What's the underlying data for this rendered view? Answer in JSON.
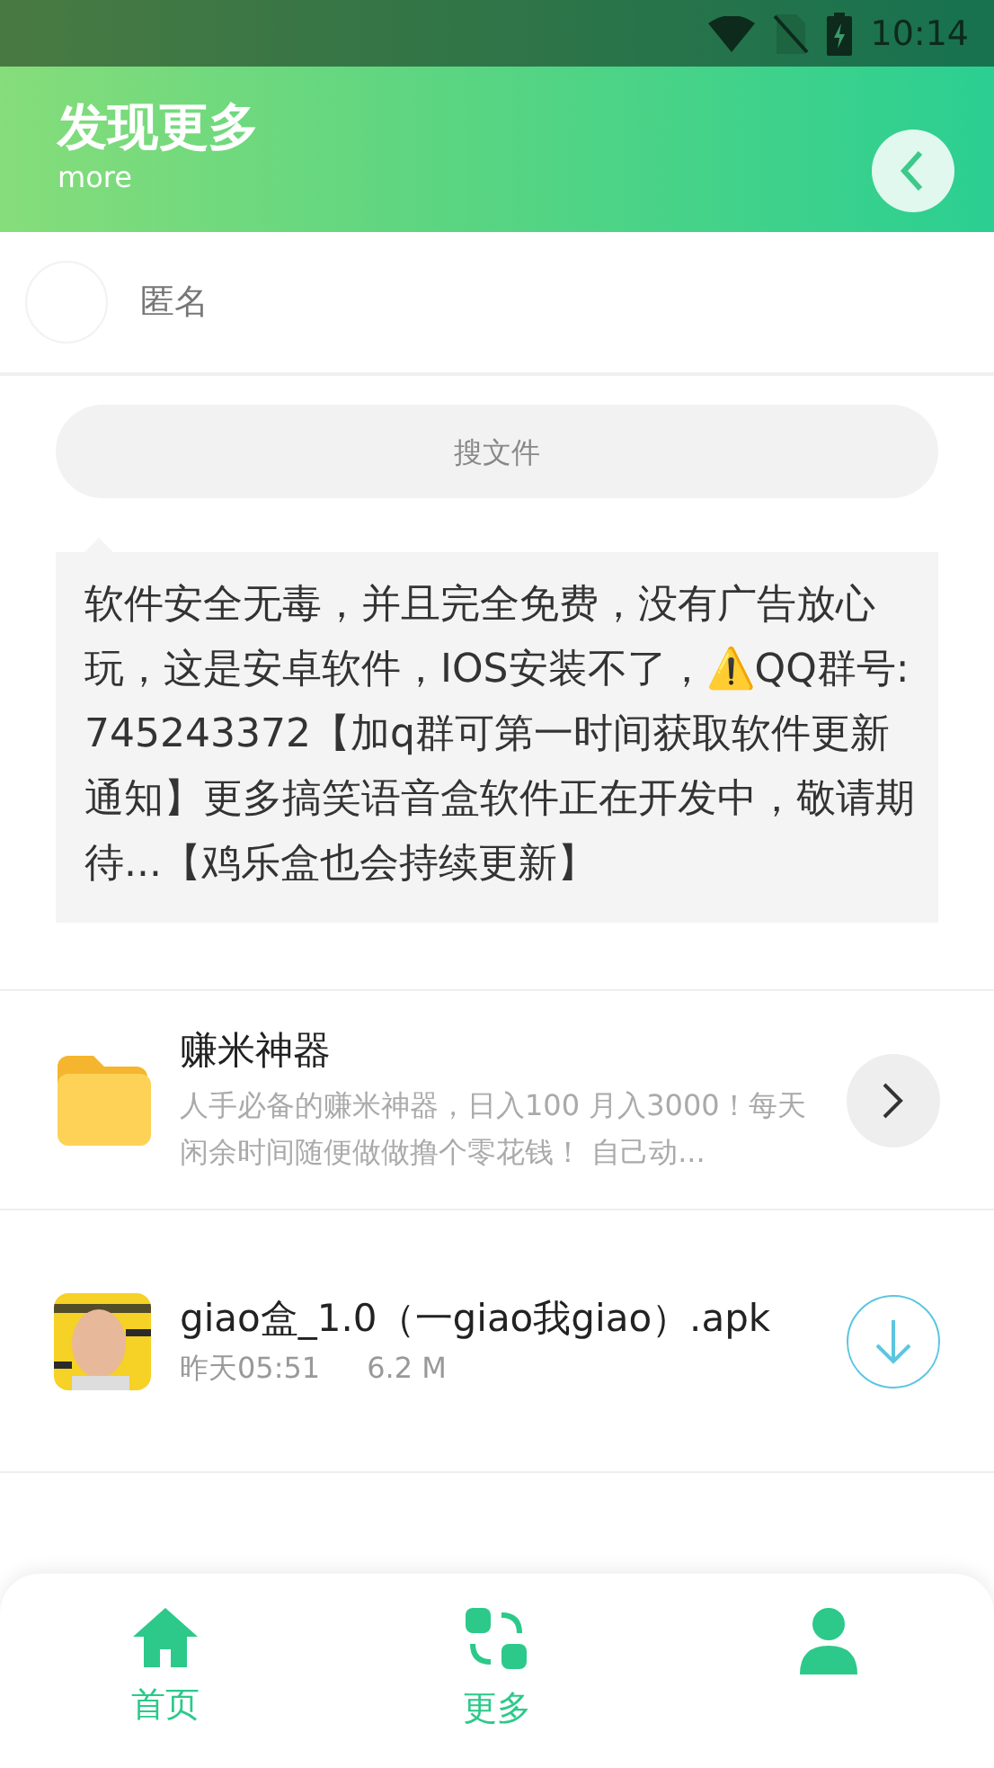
{
  "status_bar": {
    "time": "10:14"
  },
  "header": {
    "title": "发现更多",
    "subtitle": "more"
  },
  "user": {
    "name": "匿名"
  },
  "search": {
    "placeholder": "搜文件"
  },
  "notice": {
    "text": "软件安全无毒，并且完全免费，没有广告放心玩，这是安卓软件，IOS安装不了，⚠️QQ群号:745243372【加q群可第一时间获取软件更新通知】更多搞笑语音盒软件正在开发中，敬请期待...【鸡乐盒也会持续更新】"
  },
  "items": [
    {
      "kind": "folder",
      "title": "赚米神器",
      "description": "人手必备的赚米神器，日入100 月入3000！每天闲余时间随便做做撸个零花钱！ 自己动..."
    },
    {
      "kind": "file",
      "title": "giao盒_1.0（一giao我giao）.apk",
      "date": "昨天05:51",
      "size": "6.2 M"
    }
  ],
  "nav": [
    {
      "kind": "home",
      "label": "首页"
    },
    {
      "kind": "more",
      "label": "更多"
    },
    {
      "kind": "profile"
    }
  ]
}
